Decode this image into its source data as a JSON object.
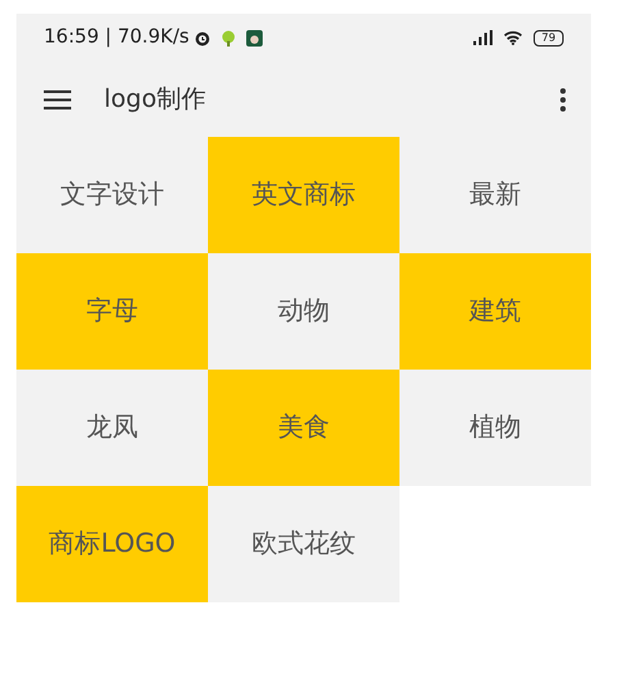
{
  "status_bar": {
    "time": "16:59 | 70.9K/s",
    "battery": "79"
  },
  "app_bar": {
    "title": "logo制作"
  },
  "tiles": [
    {
      "label": "文字设计",
      "color": "#f2f2f2"
    },
    {
      "label": "英文商标",
      "color": "#ffcc00"
    },
    {
      "label": "最新",
      "color": "#f2f2f2"
    },
    {
      "label": "字母",
      "color": "#ffcc00"
    },
    {
      "label": "动物",
      "color": "#f2f2f2"
    },
    {
      "label": "建筑",
      "color": "#ffcc00"
    },
    {
      "label": "龙凤",
      "color": "#f2f2f2"
    },
    {
      "label": "美食",
      "color": "#ffcc00"
    },
    {
      "label": "植物",
      "color": "#f2f2f2"
    },
    {
      "label": "商标LOGO",
      "color": "#ffcc00"
    },
    {
      "label": "欧式花纹",
      "color": "#f2f2f2"
    }
  ]
}
